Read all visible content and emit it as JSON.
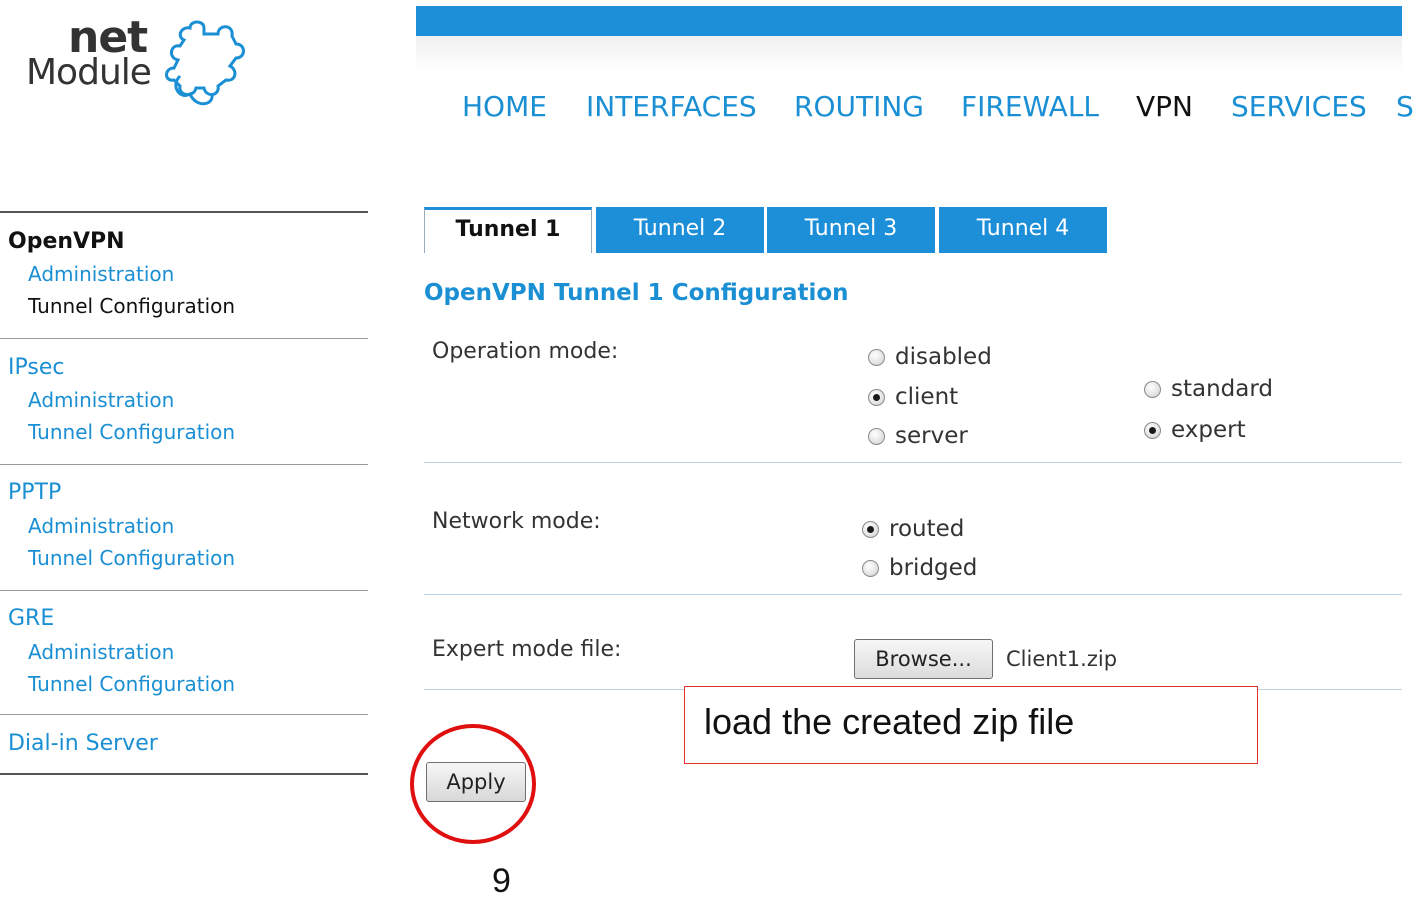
{
  "logo": {
    "word1": "net",
    "word2": "Module"
  },
  "nav": {
    "items": [
      {
        "label": "HOME",
        "active": false
      },
      {
        "label": "INTERFACES",
        "active": false
      },
      {
        "label": "ROUTING",
        "active": false
      },
      {
        "label": "FIREWALL",
        "active": false
      },
      {
        "label": "VPN",
        "active": true
      },
      {
        "label": "SERVICES",
        "active": false
      },
      {
        "label": "S",
        "active": false
      }
    ]
  },
  "sidebar": {
    "groups": [
      {
        "title": "OpenVPN",
        "active": true,
        "links": [
          "Administration",
          "Tunnel Configuration"
        ],
        "active_link": "Tunnel Configuration"
      },
      {
        "title": "IPsec",
        "active": false,
        "links": [
          "Administration",
          "Tunnel Configuration"
        ]
      },
      {
        "title": "PPTP",
        "active": false,
        "links": [
          "Administration",
          "Tunnel Configuration"
        ]
      },
      {
        "title": "GRE",
        "active": false,
        "links": [
          "Administration",
          "Tunnel Configuration"
        ]
      },
      {
        "title": "Dial-in Server",
        "active": false,
        "links": []
      }
    ]
  },
  "tabs": [
    {
      "label": "Tunnel 1",
      "active": true
    },
    {
      "label": "Tunnel 2",
      "active": false
    },
    {
      "label": "Tunnel 3",
      "active": false
    },
    {
      "label": "Tunnel 4",
      "active": false
    }
  ],
  "form": {
    "title": "OpenVPN Tunnel 1 Configuration",
    "operation_mode": {
      "label": "Operation mode:",
      "options": [
        "disabled",
        "client",
        "server"
      ],
      "selected": "client",
      "sub_options": [
        "standard",
        "expert"
      ],
      "sub_selected": "expert"
    },
    "network_mode": {
      "label": "Network mode:",
      "options": [
        "routed",
        "bridged"
      ],
      "selected": "routed"
    },
    "expert_file": {
      "label": "Expert mode file:",
      "button": "Browse...",
      "file": "Client1.zip"
    },
    "apply": "Apply"
  },
  "annotations": {
    "callout": "load the created zip file",
    "step": "9"
  },
  "colors": {
    "accent": "#1a8fd4",
    "highlight": "#e01010"
  }
}
